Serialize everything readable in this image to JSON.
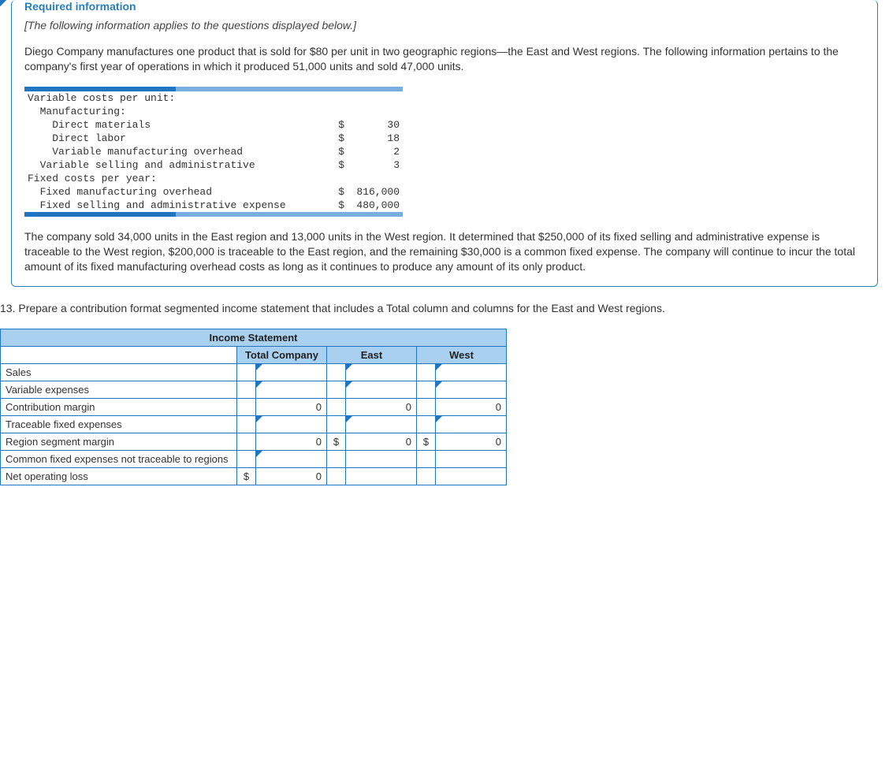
{
  "info": {
    "required_title": "Required information",
    "italic_msg": "[The following information applies to the questions displayed below.]",
    "para1": "Diego Company manufactures one product that is sold for $80 per unit in two geographic regions—the East and West regions. The following information pertains to the company's first year of operations in which it produced 51,000 units and sold 47,000 units.",
    "para2": "The company sold 34,000 units in the East region and 13,000 units in the West region. It determined that $250,000 of its fixed selling and administrative expense is traceable to the West region, $200,000 is traceable to the East region, and the remaining $30,000 is a common fixed expense. The company will continue to incur the total amount of its fixed manufacturing overhead costs as long as it continues to produce any amount of its only product."
  },
  "costs": {
    "h1": "Variable costs per unit:",
    "h2": "  Manufacturing:",
    "r1_label": "    Direct materials",
    "r1_sym": "$",
    "r1_amt": "30",
    "r2_label": "    Direct labor",
    "r2_sym": "$",
    "r2_amt": "18",
    "r3_label": "    Variable manufacturing overhead",
    "r3_sym": "$",
    "r3_amt": "2",
    "r4_label": "  Variable selling and administrative",
    "r4_sym": "$",
    "r4_amt": "3",
    "h3": "Fixed costs per year:",
    "r5_label": "  Fixed manufacturing overhead",
    "r5_sym": "$",
    "r5_amt": "816,000",
    "r6_label": "  Fixed selling and administrative expense",
    "r6_sym": "$",
    "r6_amt": "480,000"
  },
  "question": "13. Prepare a contribution format segmented income statement that includes a Total column and columns for the East and West regions.",
  "income": {
    "title": "Income Statement",
    "col_total": "Total Company",
    "col_east": "East",
    "col_west": "West",
    "rows": {
      "sales": "Sales",
      "varexp": "Variable expenses",
      "cm": "Contribution margin",
      "trace": "Traceable fixed expenses",
      "segmargin": "Region segment margin",
      "common": "Common fixed expenses not traceable to regions",
      "netloss": "Net operating loss"
    },
    "vals": {
      "cm_total": "0",
      "cm_east": "0",
      "cm_west": "0",
      "seg_total": "0",
      "seg_east": "0",
      "seg_west": "0",
      "seg_east_sym": "$",
      "seg_west_sym": "$",
      "nl_sym": "$",
      "nl_total": "0"
    }
  }
}
